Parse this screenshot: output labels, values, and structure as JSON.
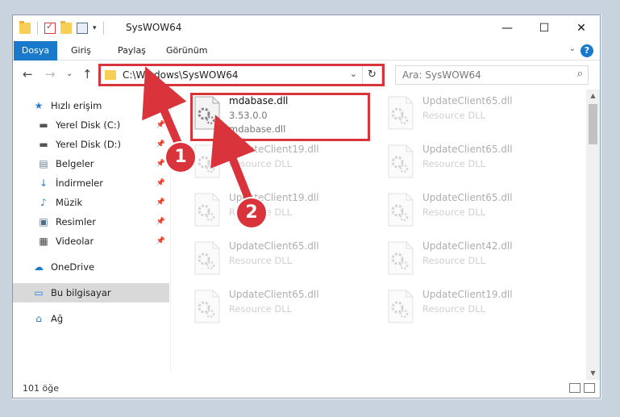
{
  "window": {
    "title": "SysWOW64",
    "minimize": "—",
    "maximize": "☐",
    "close": "✕"
  },
  "ribbon": {
    "tabs": [
      "Dosya",
      "Giriş",
      "Paylaş",
      "Görünüm"
    ],
    "help": "?",
    "accent": "#1979ca"
  },
  "navigation": {
    "back": "←",
    "forward": "→",
    "recent": "⌄",
    "up": "↑",
    "address": "C:\\Windows\\SysWOW64",
    "refresh": "↻",
    "search_placeholder": "Ara: SysWOW64"
  },
  "sidebar": {
    "items": [
      {
        "label": "Hızlı erişim",
        "icon": "star-icon",
        "pinned": false,
        "indent": 0
      },
      {
        "label": "Yerel Disk (C:)",
        "icon": "drive-icon",
        "pinned": true,
        "indent": 1
      },
      {
        "label": "Yerel Disk (D:)",
        "icon": "drive-icon",
        "pinned": true,
        "indent": 1
      },
      {
        "label": "Belgeler",
        "icon": "documents-icon",
        "pinned": true,
        "indent": 1
      },
      {
        "label": "İndirmeler",
        "icon": "downloads-icon",
        "pinned": true,
        "indent": 1
      },
      {
        "label": "Müzik",
        "icon": "music-icon",
        "pinned": true,
        "indent": 1
      },
      {
        "label": "Resimler",
        "icon": "pictures-icon",
        "pinned": true,
        "indent": 1
      },
      {
        "label": "Videolar",
        "icon": "videos-icon",
        "pinned": true,
        "indent": 1
      },
      {
        "label": "OneDrive",
        "icon": "onedrive-icon",
        "pinned": false,
        "indent": 0
      },
      {
        "label": "Bu bilgisayar",
        "icon": "computer-icon",
        "pinned": false,
        "indent": 0,
        "selected": true
      },
      {
        "label": "Ağ",
        "icon": "network-icon",
        "pinned": false,
        "indent": 0
      }
    ]
  },
  "files": [
    {
      "name": "mdabase.dll",
      "version": "3.53.0.0",
      "description": "mdabase.dll",
      "highlighted": true
    },
    {
      "name": "UpdateClient65.dll",
      "description": "Resource DLL"
    },
    {
      "name": "UpdateClient19.dll",
      "description": "Resource DLL"
    },
    {
      "name": "UpdateClient65.dll",
      "description": "Resource DLL"
    },
    {
      "name": "UpdateClient19.dll",
      "description": "Resource DLL"
    },
    {
      "name": "UpdateClient65.dll",
      "description": "Resource DLL"
    },
    {
      "name": "UpdateClient65.dll",
      "description": "Resource DLL"
    },
    {
      "name": "UpdateClient42.dll",
      "description": "Resource DLL"
    },
    {
      "name": "UpdateClient65.dll",
      "description": "Resource DLL"
    },
    {
      "name": "UpdateClient19.dll",
      "description": "Resource DLL"
    }
  ],
  "status": {
    "count": "101 öğe"
  },
  "annotations": {
    "step1": "1",
    "step2": "2",
    "color": "#d9343b"
  }
}
